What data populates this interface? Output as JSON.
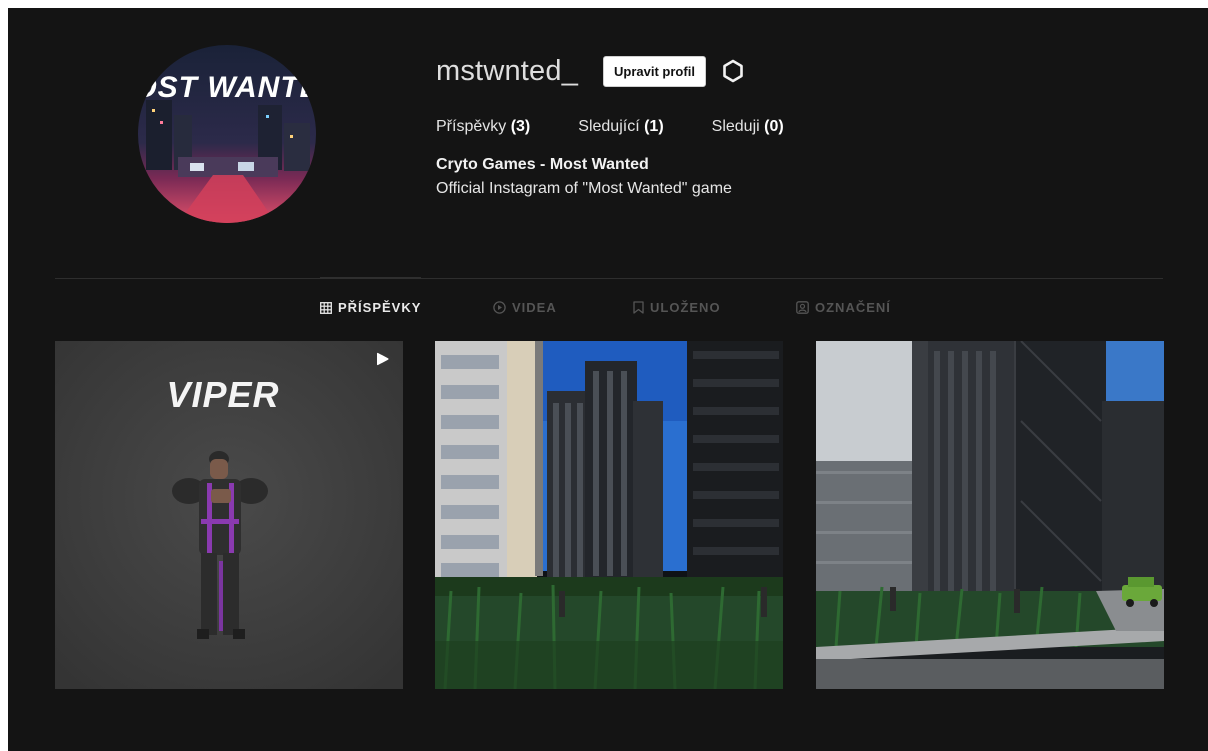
{
  "profile": {
    "avatar_text": "OST WANTE",
    "username": "mstwnted_",
    "edit_label": "Upravit profil",
    "stats": [
      {
        "label": "Příspěvky",
        "count": "(3)"
      },
      {
        "label": "Sledující",
        "count": "(1)"
      },
      {
        "label": "Sleduji",
        "count": "(0)"
      }
    ],
    "bio_name": "Cryto Games - Most Wanted",
    "bio_text": "Official Instagram of \"Most Wanted\" game"
  },
  "tabs": [
    {
      "label": "PŘÍSPĚVKY",
      "icon": "grid-icon",
      "active": true
    },
    {
      "label": "VIDEA",
      "icon": "play-circle-icon",
      "active": false
    },
    {
      "label": "ULOŽENO",
      "icon": "bookmark-icon",
      "active": false
    },
    {
      "label": "OZNAČENÍ",
      "icon": "tagged-user-icon",
      "active": false
    }
  ],
  "posts": [
    {
      "title": "VIPER",
      "type": "video",
      "icon": "play-icon"
    },
    {
      "type": "image"
    },
    {
      "type": "image"
    }
  ],
  "colors": {
    "background": "#141414",
    "text": "#e8e8e8",
    "inactive_tab": "#555555",
    "button_bg": "#ffffff"
  }
}
